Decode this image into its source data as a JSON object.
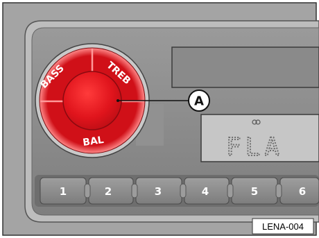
{
  "knob": {
    "labels": {
      "bass": "BASS",
      "treble": "TREB",
      "balance": "BAL"
    },
    "color": "#d9141c"
  },
  "callout": {
    "letter": "A"
  },
  "display": {
    "icon": "stereo-icon",
    "text": "FLA"
  },
  "presets": [
    "1",
    "2",
    "3",
    "4",
    "5",
    "6"
  ],
  "reference": {
    "code": "LENA-004"
  },
  "colors": {
    "panel": "#8c8c8c",
    "bezel": "#b5b5b5",
    "background": "#a3a3a3",
    "lcd": "#c4c4c4",
    "knob": "#d9141c"
  }
}
